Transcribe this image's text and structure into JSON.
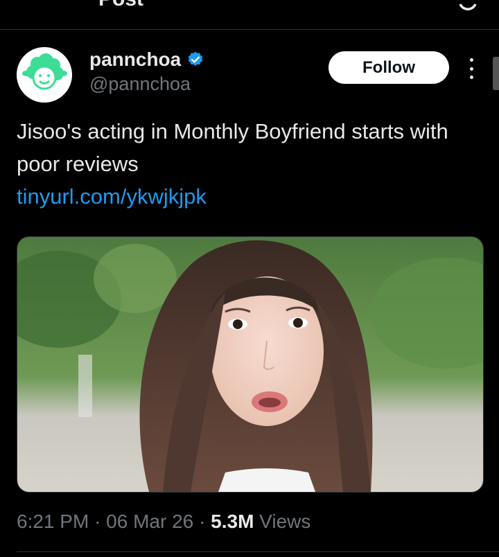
{
  "header": {
    "title": "Post"
  },
  "author": {
    "display_name": "pannchoa",
    "handle": "@pannchoa",
    "verified": true,
    "avatar_icon": "sheep-logo-icon",
    "avatar_color": "#3ddc97"
  },
  "actions": {
    "follow_label": "Follow",
    "more_icon": "more-vertical-icon"
  },
  "tweet": {
    "text": "Jisoo's acting in Monthly Boyfriend starts with poor reviews",
    "link": "tinyurl.com/ykwjkjpk"
  },
  "media": {
    "alt": "Drama still of a woman with long brown hair looking surprised"
  },
  "meta": {
    "time": "6:21 PM",
    "date": "06 Mar 26",
    "views_count": "5.3M",
    "views_label": "Views",
    "separator": "·"
  },
  "colors": {
    "link": "#1d9bf0",
    "verified": "#1d9bf0",
    "muted": "#71767b",
    "background": "#000000"
  }
}
